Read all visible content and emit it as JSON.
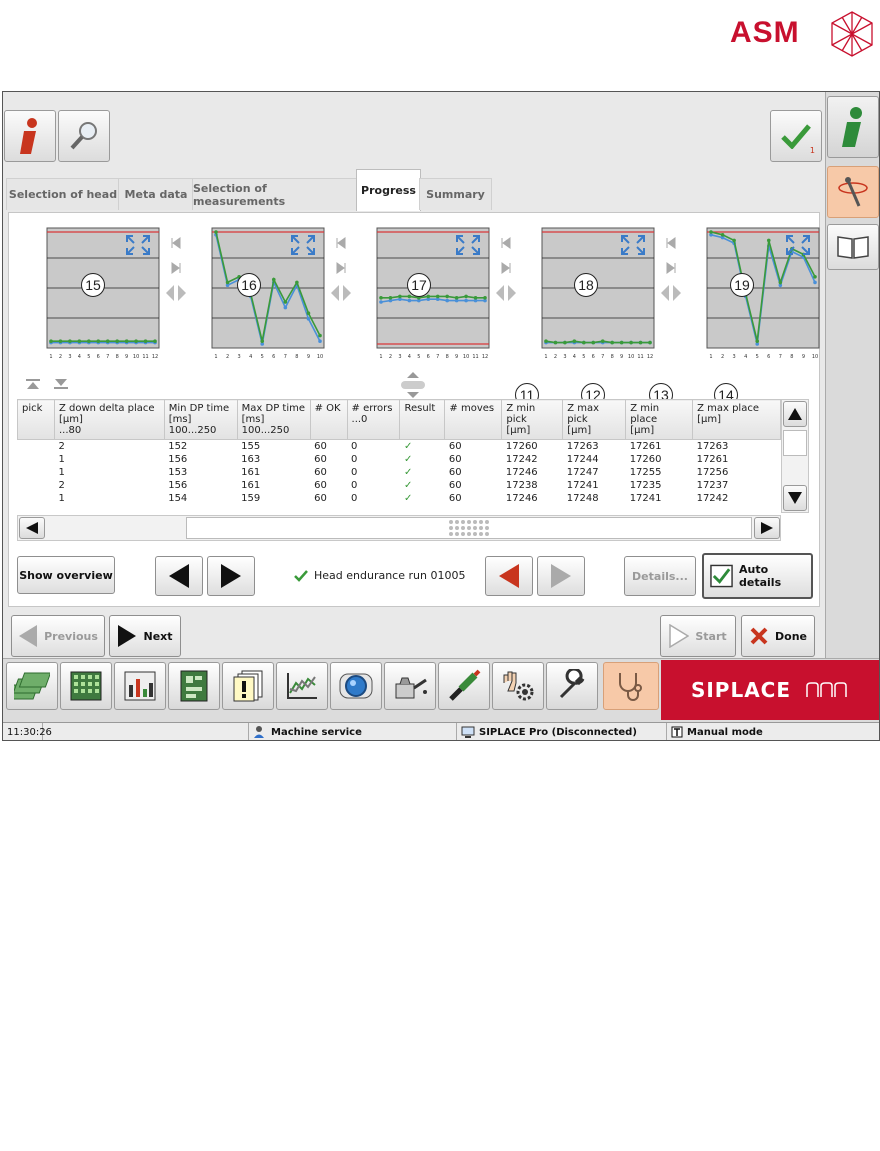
{
  "brand": {
    "logo_text": "ASM",
    "siplace_text": "SIPLACE"
  },
  "tabs": [
    {
      "label": "Selection of head",
      "active": false
    },
    {
      "label": "Meta data",
      "active": false
    },
    {
      "label": "Selection of measurements",
      "active": false
    },
    {
      "label": "Progress",
      "active": true
    },
    {
      "label": "Summary",
      "active": false
    }
  ],
  "check_badge": "1",
  "charts": [
    {
      "number": "15",
      "series": [
        [
          1,
          1,
          1,
          1,
          1,
          1,
          1,
          1,
          1,
          1,
          1,
          1
        ],
        [
          2,
          2,
          2,
          2,
          2,
          2,
          2,
          2,
          2,
          2,
          2,
          2
        ]
      ]
    },
    {
      "number": "16",
      "series": [
        [
          78,
          42,
          46,
          34,
          0,
          44,
          26,
          42,
          18,
          2
        ],
        [
          80,
          44,
          48,
          36,
          2,
          46,
          30,
          44,
          22,
          6
        ]
      ]
    },
    {
      "number": "17",
      "series": [
        [
          30,
          31,
          32,
          31,
          31,
          32,
          32,
          31,
          31,
          31,
          31,
          31
        ],
        [
          33,
          33,
          34,
          34,
          33,
          34,
          34,
          34,
          33,
          34,
          33,
          33
        ]
      ]
    },
    {
      "number": "18",
      "series": [
        [
          1,
          1,
          1,
          1,
          1,
          1,
          1,
          1,
          1,
          1,
          1,
          1
        ],
        [
          2,
          1,
          1,
          2,
          1,
          1,
          2,
          1,
          1,
          1,
          1,
          1
        ]
      ]
    },
    {
      "number": "19",
      "series": [
        [
          78,
          76,
          72,
          34,
          0,
          70,
          42,
          66,
          62,
          44
        ],
        [
          80,
          78,
          74,
          36,
          2,
          74,
          44,
          68,
          64,
          48
        ]
      ]
    }
  ],
  "column_numbers": [
    "11",
    "12",
    "13",
    "14"
  ],
  "table": {
    "headers": [
      [
        "pick"
      ],
      [
        "Z down delta place",
        "[µm]",
        "...80"
      ],
      [
        "Min DP time",
        "[ms]",
        "100...250"
      ],
      [
        "Max DP time",
        "[ms]",
        "100...250"
      ],
      [
        "# OK"
      ],
      [
        "# errors",
        "...0"
      ],
      [
        "Result"
      ],
      [
        "# moves"
      ],
      [
        "Z min pick",
        "[µm]"
      ],
      [
        "Z max pick",
        "[µm]"
      ],
      [
        "Z min place",
        "[µm]"
      ],
      [
        "Z max place",
        "[µm]"
      ]
    ],
    "rows": [
      [
        "",
        "2",
        "152",
        "155",
        "60",
        "0",
        "✓",
        "60",
        "17260",
        "17263",
        "17261",
        "17263"
      ],
      [
        "",
        "1",
        "156",
        "163",
        "60",
        "0",
        "✓",
        "60",
        "17242",
        "17244",
        "17260",
        "17261"
      ],
      [
        "",
        "1",
        "153",
        "161",
        "60",
        "0",
        "✓",
        "60",
        "17246",
        "17247",
        "17255",
        "17256"
      ],
      [
        "",
        "2",
        "156",
        "161",
        "60",
        "0",
        "✓",
        "60",
        "17238",
        "17241",
        "17235",
        "17237"
      ],
      [
        "",
        "1",
        "154",
        "159",
        "60",
        "0",
        "✓",
        "60",
        "17246",
        "17248",
        "17241",
        "17242"
      ]
    ]
  },
  "controls": {
    "show_overview": "Show overview",
    "run_label": "Head endurance run 01005",
    "details": "Details...",
    "auto_details": "Auto details",
    "previous": "Previous",
    "next": "Next",
    "start": "Start",
    "done": "Done"
  },
  "status": {
    "time": "11:30:26",
    "machine_service": "Machine service",
    "siplace_pro": "SIPLACE Pro (Disconnected)",
    "manual_mode": "Manual mode"
  },
  "colors": {
    "accent_red": "#c8102e",
    "green": "#3a9a3a",
    "blue": "#4a90d9",
    "highlight": "#f7c9a8"
  }
}
